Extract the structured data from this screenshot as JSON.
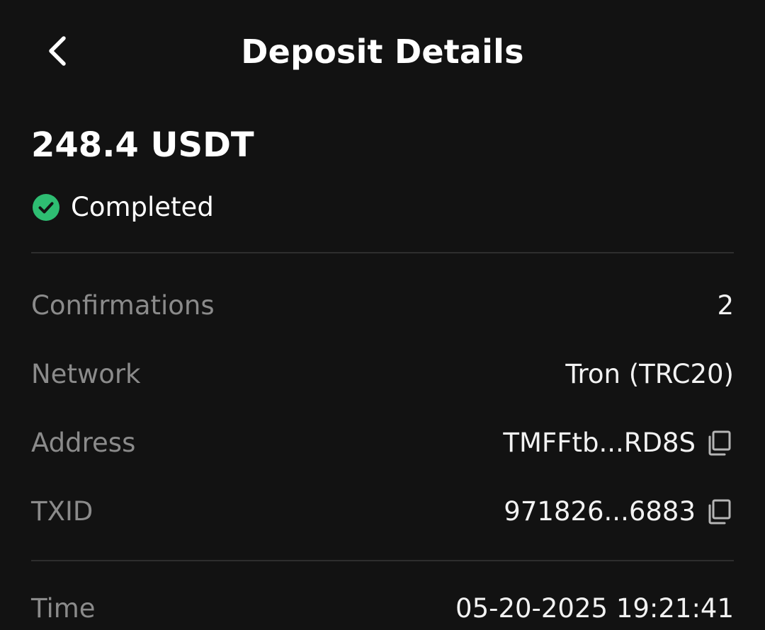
{
  "header": {
    "title": "Deposit Details",
    "back_icon": "chevron-left-icon"
  },
  "summary": {
    "amount": "248.4 USDT",
    "status": "Completed",
    "status_icon": "check-circle-icon",
    "status_color": "#2ebd72"
  },
  "details": {
    "confirmations": {
      "label": "Confirmations",
      "value": "2"
    },
    "network": {
      "label": "Network",
      "value": "Tron (TRC20)"
    },
    "address": {
      "label": "Address",
      "value": "TMFFtb...RD8S",
      "icon": "copy-icon"
    },
    "txid": {
      "label": "TXID",
      "value": "971826...6883",
      "icon": "copy-icon"
    },
    "time": {
      "label": "Time",
      "value": "05-20-2025 19:21:41"
    }
  },
  "colors": {
    "background": "#121212",
    "divider": "#2e2e2e",
    "label": "#8b8b8b",
    "value": "#f2f2f2"
  }
}
